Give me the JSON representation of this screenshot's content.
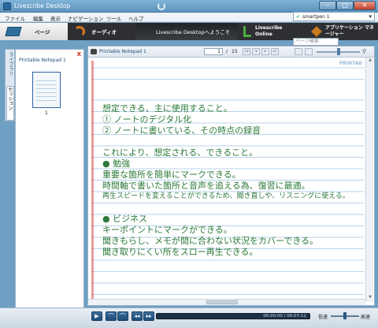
{
  "window": {
    "title": "Livescribe Desktop"
  },
  "menu": [
    "ファイル",
    "編集",
    "表示",
    "ナビゲーション",
    "ツール",
    "ヘルプ"
  ],
  "user_select": {
    "value": "smartpen 1"
  },
  "tabs": {
    "pages": "ページ",
    "audio": "オーディオ",
    "welcome": "Livescribe Desktopへようこそ",
    "online": "Livescribe Online",
    "apps": "アプリケーション マネージャー"
  },
  "search": {
    "placeholder": "ページ検索"
  },
  "sidenav": {
    "library": "ライブラリ",
    "session": "セッション"
  },
  "panel": {
    "header": "Printable Notepad 1",
    "close": "X",
    "thumb_number": "1"
  },
  "viewer": {
    "notebook": "Printable Notepad 1",
    "page_current": "1",
    "page_sep": "/",
    "page_total": "15",
    "brand": "PRINTAB"
  },
  "notes": [
    "想定できる、主に使用すること。",
    "① ノートのデジタル化",
    "② ノートに書いている、その時点の録音",
    "これにより、想定される、できること。",
    "● 勉強",
    "重要な箇所を簡単にマークできる。",
    "時間軸で書いた箇所と音声を追える為、復習に最適。",
    "再生スピードを変えることができるため、聞き直しや、リスニングに使える。",
    "● ビジネス",
    "キーポイントにマークができる。",
    "聞きもらし、メモが間に合わない状況をカバーできる。",
    "聞き取りにくい所をスロー再生できる。"
  ],
  "playback": {
    "time": "00:00:00 / 00:07:12",
    "progress": 0.0,
    "slow": "低速",
    "fast": "高速"
  },
  "colors": {
    "ink": "#2b7a3a",
    "accent": "#2d6f9c",
    "tabbar": "#2d2f33"
  }
}
